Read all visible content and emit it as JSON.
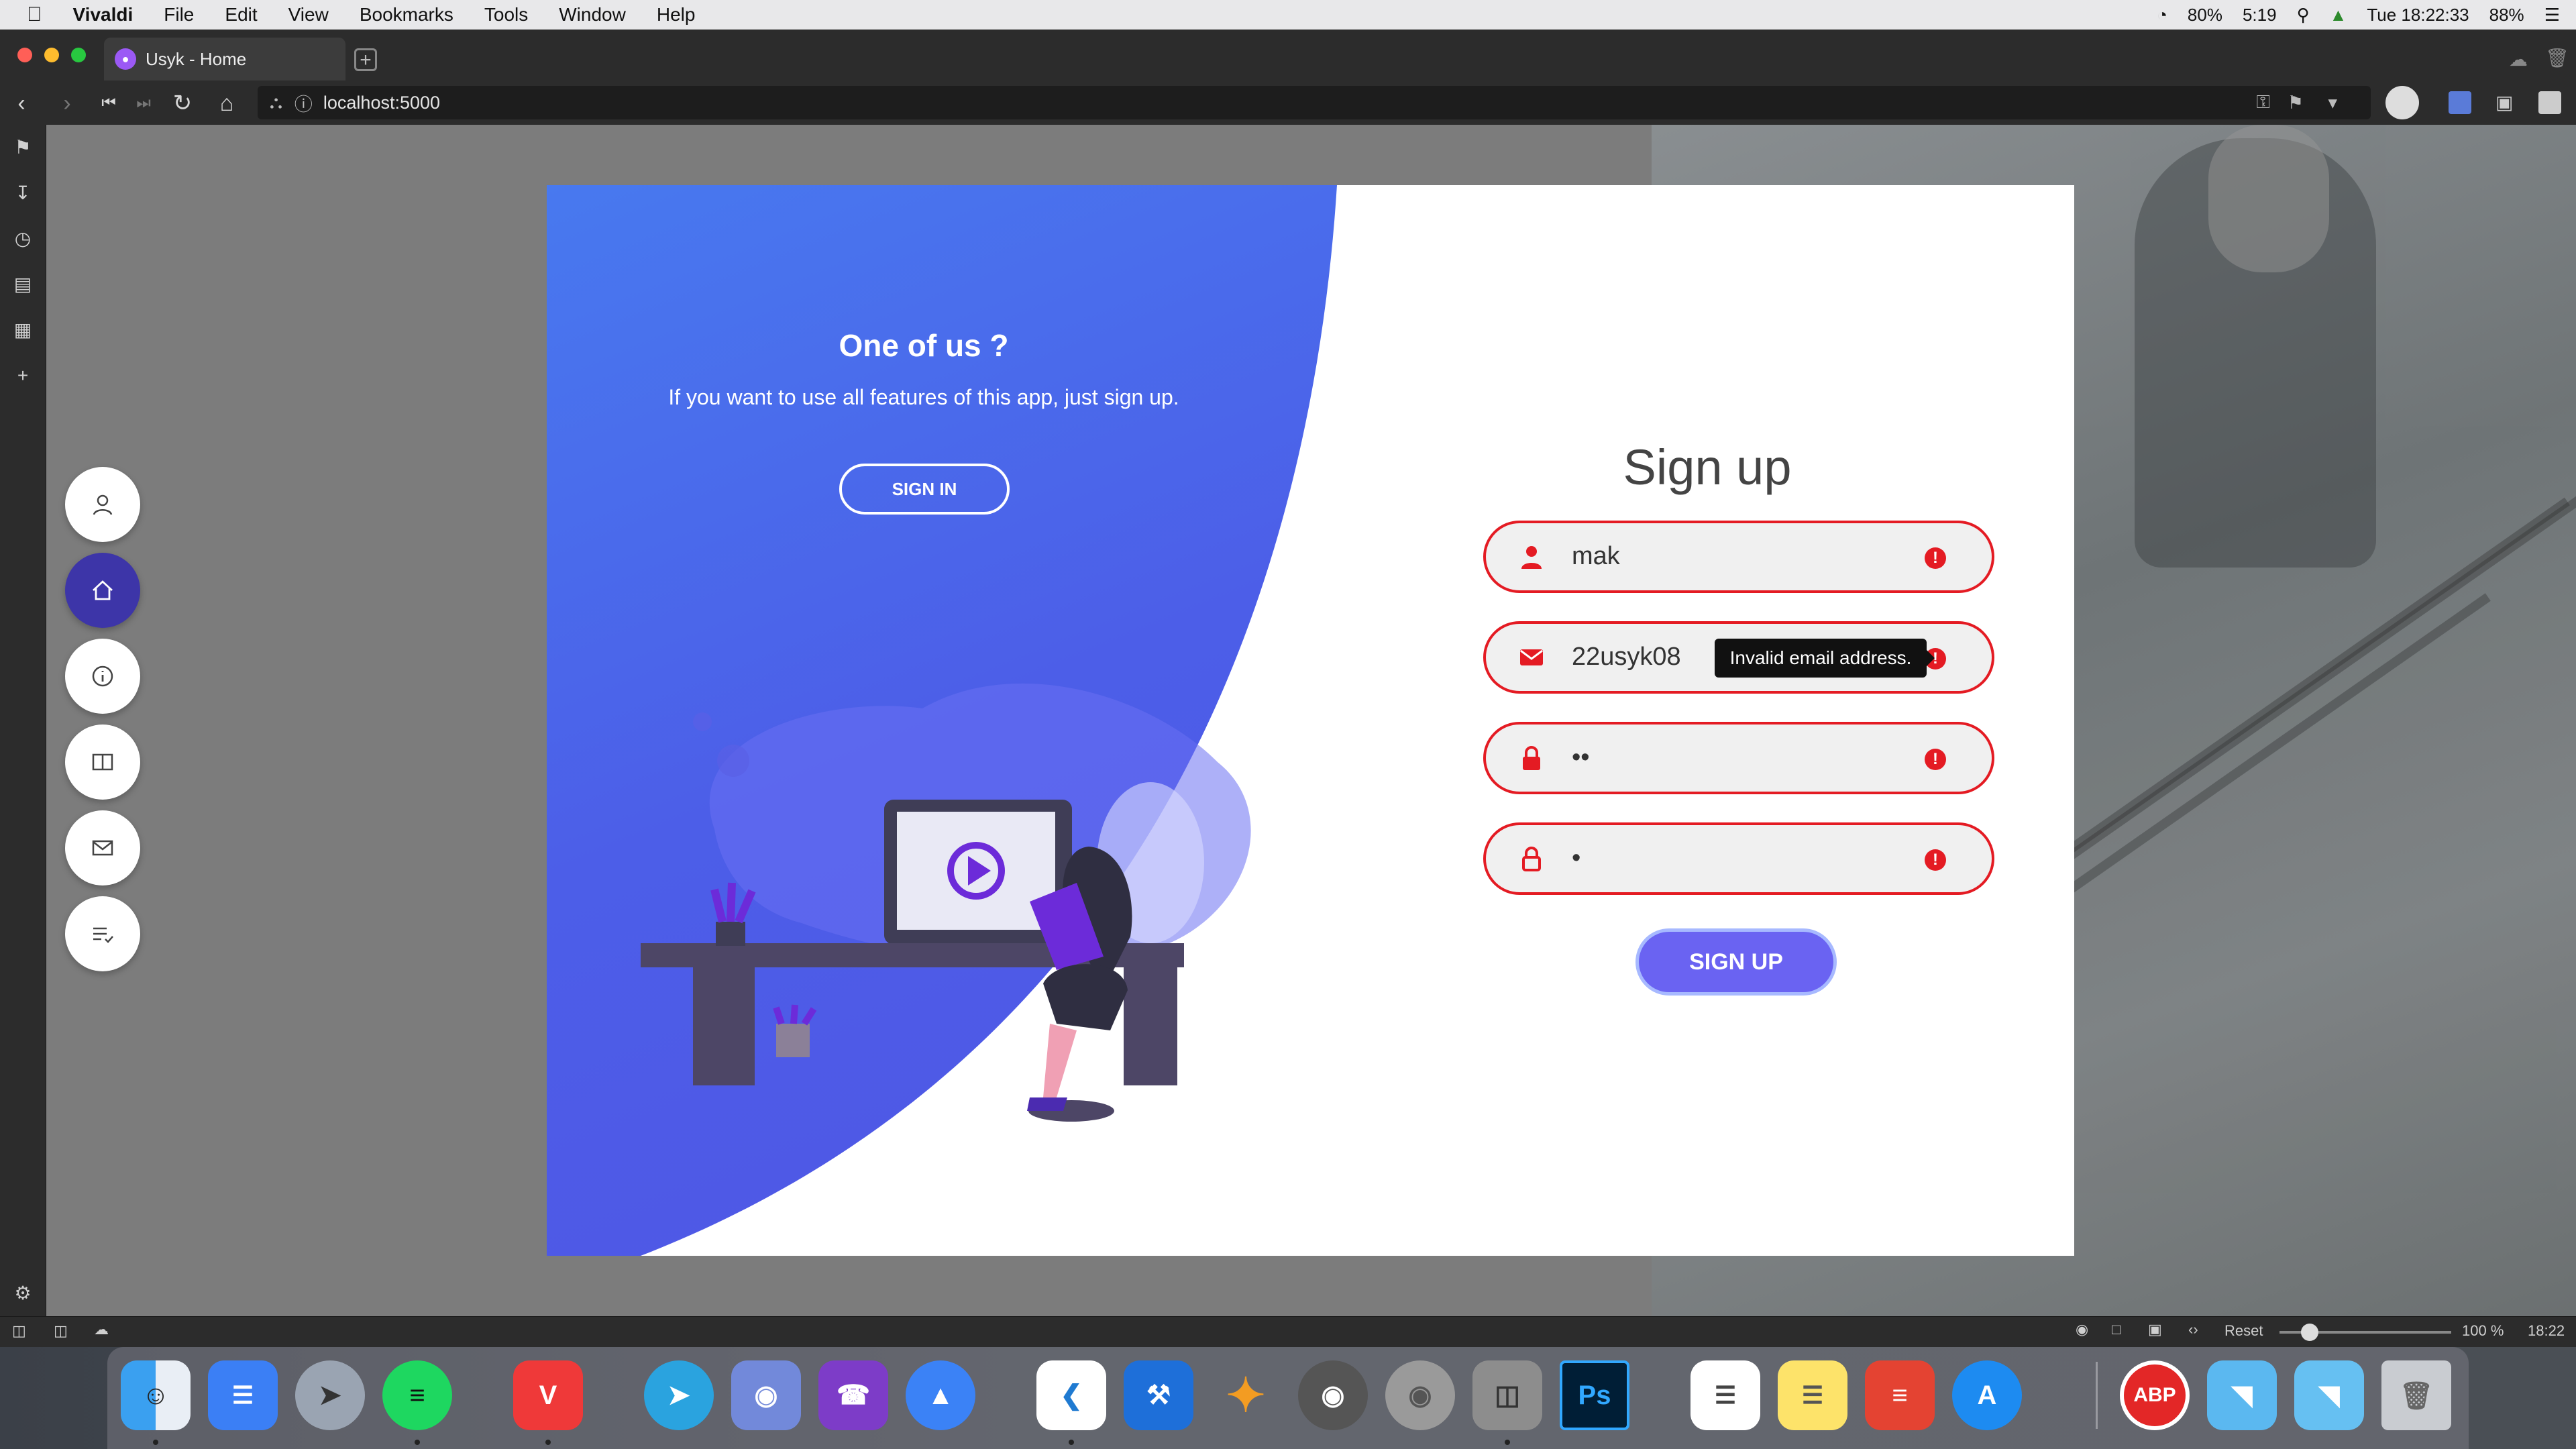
{
  "menubar": {
    "app_name": "Vivaldi",
    "items": [
      "File",
      "Edit",
      "View",
      "Bookmarks",
      "Tools",
      "Window",
      "Help"
    ],
    "status": {
      "cpu": "80%",
      "time_short": "5:19",
      "datetime": "Tue 18:22:33",
      "battery": "88%"
    }
  },
  "tab": {
    "title": "Usyk - Home"
  },
  "address": {
    "url": "localhost:5000"
  },
  "sidebar_nav": [
    "user-icon",
    "home-icon",
    "info-icon",
    "book-icon",
    "mail-icon",
    "list-icon"
  ],
  "hero": {
    "title": "One of us ?",
    "text": "If you want to use all features of this app, just sign up.",
    "signin_label": "SIGN IN"
  },
  "form": {
    "title": "Sign up",
    "username_value": "mak",
    "email_value": "22usyk08",
    "password_value": "••",
    "confirm_value": "•",
    "error_icon": "!",
    "tooltip": "Invalid email address.",
    "submit_label": "SIGN UP"
  },
  "statusbar": {
    "reset_label": "Reset",
    "zoom": "100 %",
    "clock": "18:22"
  },
  "colors": {
    "accent": "#6a63f2",
    "error": "#e41b23",
    "blue_panel": "#4a63e8",
    "nav_active": "#3d35a8"
  },
  "dock": {
    "apps": [
      "Finder",
      "Reminders-like",
      "Rocket",
      "Spotify",
      "Vivaldi",
      "Telegram",
      "Discord",
      "Viber",
      "Spark",
      "VS Code",
      "Xcode",
      "Transmit",
      "TablePlus",
      "Disk Utility",
      "Sequel",
      "Photoshop",
      "Reminders",
      "Notes",
      "Todoist",
      "App Store",
      "AdBlock",
      "Folder",
      "Downloads",
      "Trash"
    ],
    "photoshop_label": "Ps",
    "adblock_label": "ABP"
  }
}
